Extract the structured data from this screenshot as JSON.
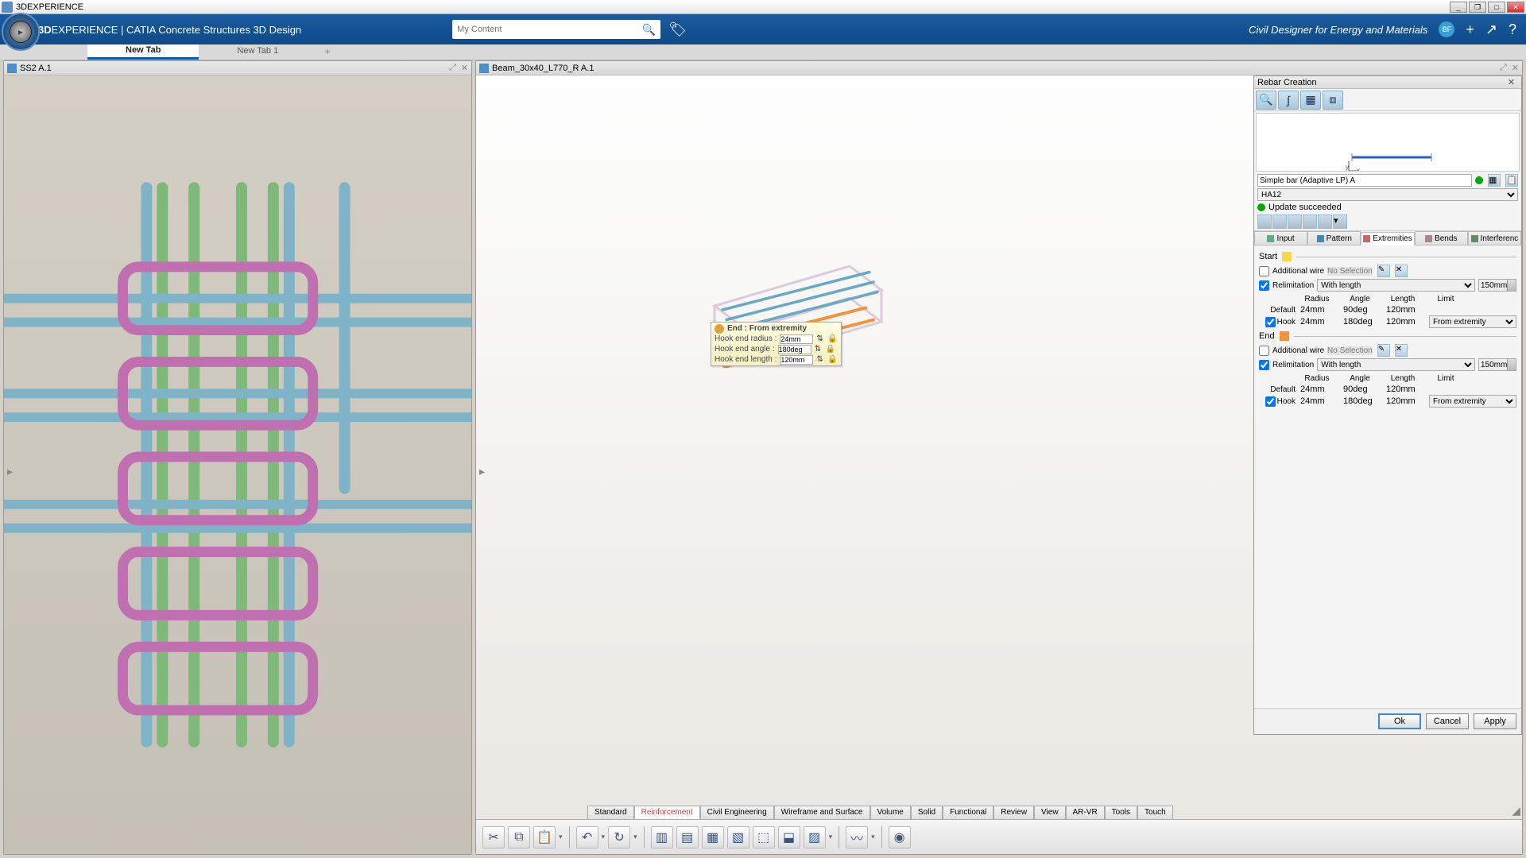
{
  "window": {
    "title": "3DEXPERIENCE"
  },
  "topbar": {
    "brand_html": "3DEXPERIENCE | CATIA Concrete Structures 3D Design",
    "brand_prefix": "3D",
    "brand_rest": "EXPERIENCE | CATIA Concrete Structures 3D Design",
    "search_placeholder": "My Content",
    "role": "Civil Designer for Energy and Materials",
    "avatar": "BF"
  },
  "tabs": {
    "active": "New Tab",
    "other": "New Tab 1"
  },
  "panes": {
    "left_title": "SS2 A.1",
    "right_title": "Beam_30x40_L770_R A.1"
  },
  "callout": {
    "title": "End : From extremity",
    "rows": [
      {
        "label": "Hook end radius :",
        "val": "24mm"
      },
      {
        "label": "Hook end angle :",
        "val": "180deg"
      },
      {
        "label": "Hook end length :",
        "val": "120mm"
      }
    ]
  },
  "panel": {
    "title": "Rebar Creation",
    "bar_name": "Simple bar (Adaptive LP) A",
    "bar_type": "HA12",
    "status": "Update succeeded",
    "axes": {
      "x": "x",
      "y": "y"
    },
    "tabs": [
      "Input",
      "Pattern",
      "Extremities",
      "Bends",
      "Interferenc"
    ],
    "active_tab": "Extremities",
    "start": {
      "label": "Start",
      "color": "#f5d94a",
      "add_wire_label": "Additional wire",
      "add_wire_checked": false,
      "add_wire_value": "No Selection",
      "relim_label": "Relimitation",
      "relim_checked": true,
      "relim_mode": "With length",
      "relim_value": "150mm",
      "cols": [
        "Radius",
        "Angle",
        "Length",
        "Limit"
      ],
      "default_label": "Default",
      "default": {
        "radius": "24mm",
        "angle": "90deg",
        "length": "120mm"
      },
      "hook_label": "Hook",
      "hook_checked": true,
      "hook": {
        "radius": "24mm",
        "angle": "180deg",
        "length": "120mm",
        "limit": "From extremity"
      }
    },
    "end": {
      "label": "End",
      "color": "#f5913a",
      "add_wire_label": "Additional wire",
      "add_wire_checked": false,
      "add_wire_value": "No Selection",
      "relim_label": "Relimitation",
      "relim_checked": true,
      "relim_mode": "With length",
      "relim_value": "150mm",
      "cols": [
        "Radius",
        "Angle",
        "Length",
        "Limit"
      ],
      "default_label": "Default",
      "default": {
        "radius": "24mm",
        "angle": "90deg",
        "length": "120mm"
      },
      "hook_label": "Hook",
      "hook_checked": true,
      "hook": {
        "radius": "24mm",
        "angle": "180deg",
        "length": "120mm",
        "limit": "From extremity"
      }
    },
    "buttons": {
      "ok": "Ok",
      "cancel": "Cancel",
      "apply": "Apply"
    }
  },
  "bottom_tabs": [
    "Standard",
    "Reinforcement",
    "Civil Engineering",
    "Wireframe and Surface",
    "Volume",
    "Solid",
    "Functional",
    "Review",
    "View",
    "AR-VR",
    "Tools",
    "Touch"
  ],
  "bottom_active": "Reinforcement"
}
